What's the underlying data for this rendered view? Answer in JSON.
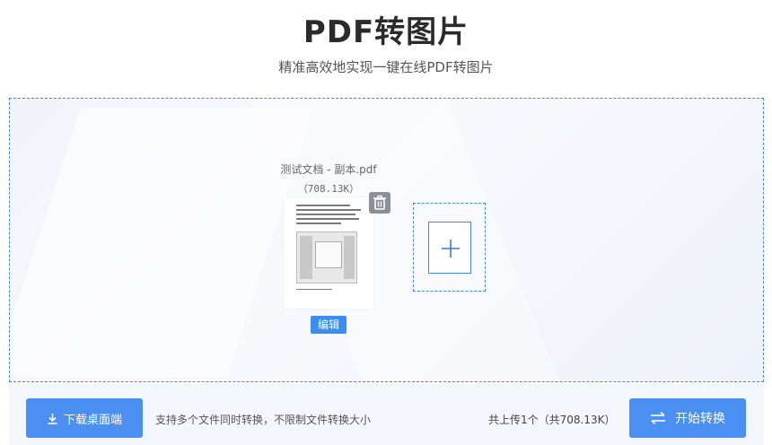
{
  "header": {
    "title": "PDF转图片",
    "subtitle": "精准高效地实现一键在线PDF转图片"
  },
  "file": {
    "name": "测试文档 - 副本.pdf",
    "size": "（708.13K）",
    "edit_label": "编辑"
  },
  "icons": {
    "trash": "trash-icon",
    "add": "plus-icon",
    "download": "download-icon",
    "convert": "swap-arrows-icon"
  },
  "footer": {
    "download_label": "下载桌面端",
    "support_text": "支持多个文件同时转换，不限制文件转换大小",
    "upload_count": "共上传1个（共708.13K）",
    "convert_label": "开始转换"
  },
  "colors": {
    "accent": "#4b8ff3",
    "dashed_border": "#4a86d8"
  }
}
